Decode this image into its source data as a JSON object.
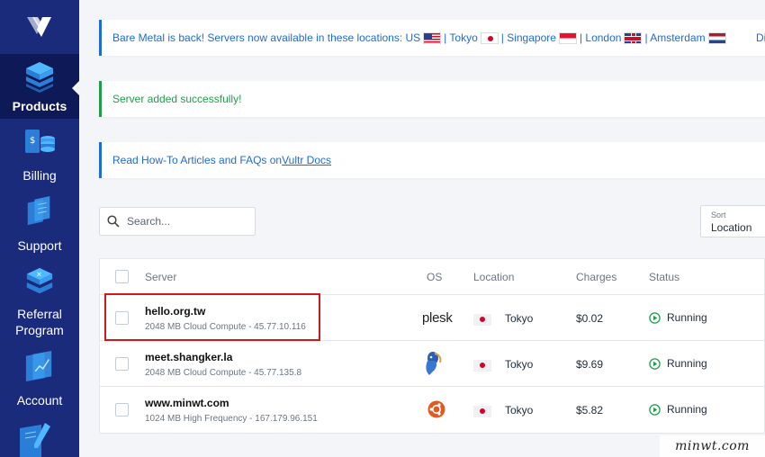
{
  "sidebar": {
    "items": [
      {
        "label": "Products",
        "active": true
      },
      {
        "label": "Billing"
      },
      {
        "label": "Support"
      },
      {
        "label": "Referral Program"
      },
      {
        "label": "Account"
      }
    ]
  },
  "banners": {
    "bare_metal": {
      "text": "Bare Metal is back! Servers now available in these locations: US",
      "tokyo": "| Tokyo",
      "singapore": "| Singapore",
      "london": "| London",
      "amsterdam": "| Amsterdam",
      "trailing": "Dis"
    },
    "success": "Server added successfully!",
    "docs": {
      "text": "Read How-To Articles and FAQs on ",
      "link": "Vultr Docs"
    }
  },
  "search": {
    "placeholder": "Search..."
  },
  "sort": {
    "label": "Sort",
    "value": "Location"
  },
  "table": {
    "headers": {
      "server": "Server",
      "os": "OS",
      "location": "Location",
      "charges": "Charges",
      "status": "Status"
    },
    "rows": [
      {
        "name": "hello.org.tw",
        "detail": "2048 MB Cloud Compute - 45.77.10.116",
        "os": "plesk",
        "location": "Tokyo",
        "charges": "$0.02",
        "status": "Running"
      },
      {
        "name": "meet.shangker.la",
        "detail": "2048 MB Cloud Compute - 45.77.135.8",
        "os": "debian-icon",
        "location": "Tokyo",
        "charges": "$9.69",
        "status": "Running"
      },
      {
        "name": "www.minwt.com",
        "detail": "1024 MB High Frequency - 167.179.96.151",
        "os": "ubuntu-icon",
        "location": "Tokyo",
        "charges": "$5.82",
        "status": "Running"
      }
    ]
  },
  "watermark": "minwt.com",
  "colors": {
    "sidebar": "#1b2b7c",
    "accent": "#1e6bd6",
    "success": "#1f9d4a",
    "highlight": "#d01a1a"
  }
}
